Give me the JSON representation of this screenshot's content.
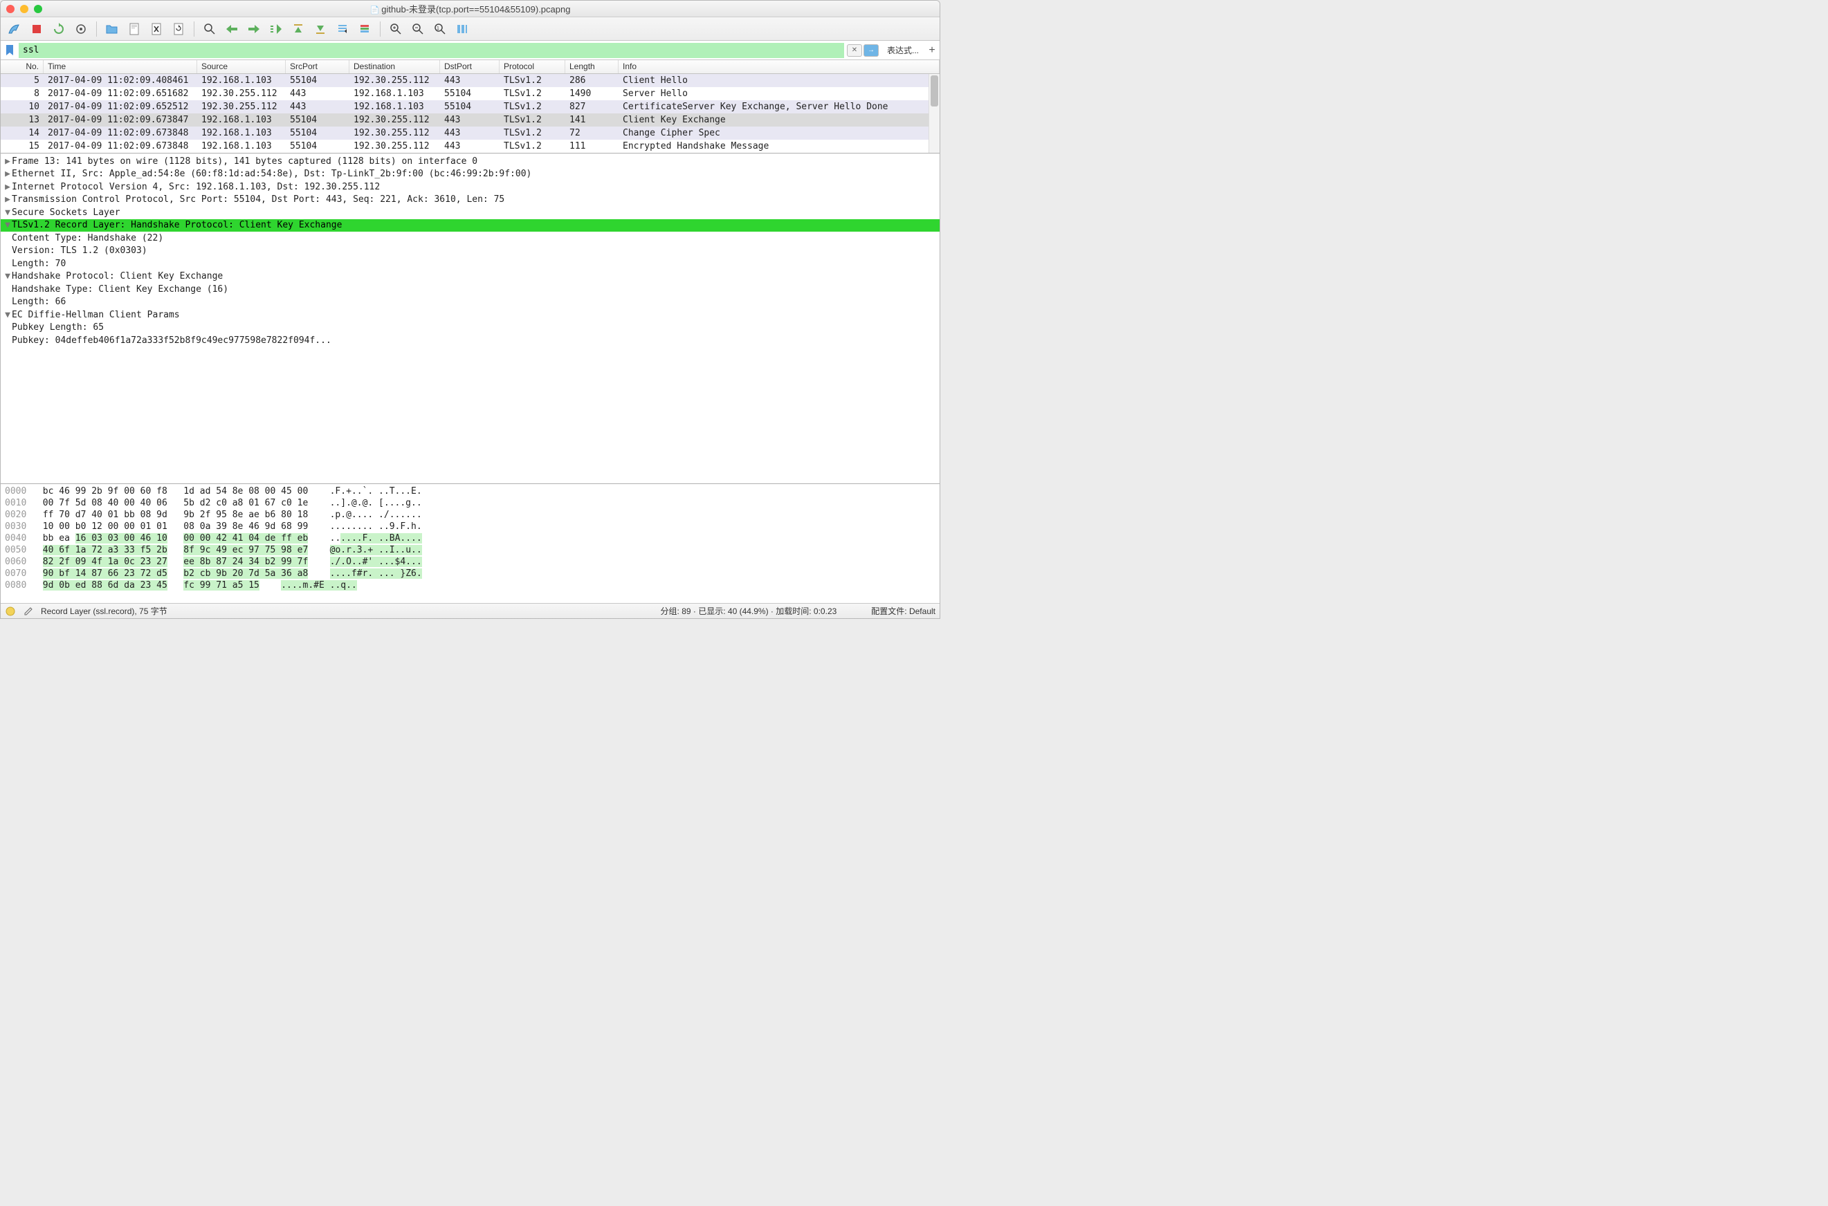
{
  "window": {
    "title": "github-未登录(tcp.port==55104&55109).pcapng"
  },
  "filter": {
    "value": "ssl",
    "expression_label": "表达式...",
    "plus": "+"
  },
  "columns": {
    "no": "No.",
    "time": "Time",
    "src": "Source",
    "sport": "SrcPort",
    "dst": "Destination",
    "dport": "DstPort",
    "proto": "Protocol",
    "len": "Length",
    "info": "Info"
  },
  "rows": [
    {
      "no": "5",
      "time": "2017-04-09 11:02:09.408461",
      "src": "192.168.1.103",
      "sport": "55104",
      "dst": "192.30.255.112",
      "dport": "443",
      "proto": "TLSv1.2",
      "len": "286",
      "info": "Client Hello",
      "sel": false,
      "even": true
    },
    {
      "no": "8",
      "time": "2017-04-09 11:02:09.651682",
      "src": "192.30.255.112",
      "sport": "443",
      "dst": "192.168.1.103",
      "dport": "55104",
      "proto": "TLSv1.2",
      "len": "1490",
      "info": "Server Hello",
      "sel": false,
      "even": false
    },
    {
      "no": "10",
      "time": "2017-04-09 11:02:09.652512",
      "src": "192.30.255.112",
      "sport": "443",
      "dst": "192.168.1.103",
      "dport": "55104",
      "proto": "TLSv1.2",
      "len": "827",
      "info": "CertificateServer Key Exchange, Server Hello Done",
      "sel": false,
      "even": true
    },
    {
      "no": "13",
      "time": "2017-04-09 11:02:09.673847",
      "src": "192.168.1.103",
      "sport": "55104",
      "dst": "192.30.255.112",
      "dport": "443",
      "proto": "TLSv1.2",
      "len": "141",
      "info": "Client Key Exchange",
      "sel": true,
      "even": false
    },
    {
      "no": "14",
      "time": "2017-04-09 11:02:09.673848",
      "src": "192.168.1.103",
      "sport": "55104",
      "dst": "192.30.255.112",
      "dport": "443",
      "proto": "TLSv1.2",
      "len": "72",
      "info": "Change Cipher Spec",
      "sel": false,
      "even": true
    },
    {
      "no": "15",
      "time": "2017-04-09 11:02:09.673848",
      "src": "192.168.1.103",
      "sport": "55104",
      "dst": "192.30.255.112",
      "dport": "443",
      "proto": "TLSv1.2",
      "len": "111",
      "info": "Encrypted Handshake Message",
      "sel": false,
      "even": false
    }
  ],
  "tree": [
    {
      "ind": 0,
      "tog": "▶",
      "text": "Frame 13: 141 bytes on wire (1128 bits), 141 bytes captured (1128 bits) on interface 0"
    },
    {
      "ind": 0,
      "tog": "▶",
      "text": "Ethernet II, Src: Apple_ad:54:8e (60:f8:1d:ad:54:8e), Dst: Tp-LinkT_2b:9f:00 (bc:46:99:2b:9f:00)"
    },
    {
      "ind": 0,
      "tog": "▶",
      "text": "Internet Protocol Version 4, Src: 192.168.1.103, Dst: 192.30.255.112"
    },
    {
      "ind": 0,
      "tog": "▶",
      "text": "Transmission Control Protocol, Src Port: 55104, Dst Port: 443, Seq: 221, Ack: 3610, Len: 75"
    },
    {
      "ind": 0,
      "tog": "▼",
      "text": "Secure Sockets Layer"
    },
    {
      "ind": 1,
      "tog": "▼",
      "text": "TLSv1.2 Record Layer: Handshake Protocol: Client Key Exchange",
      "hl": true
    },
    {
      "ind": 2,
      "tog": " ",
      "text": "Content Type: Handshake (22)"
    },
    {
      "ind": 2,
      "tog": " ",
      "text": "Version: TLS 1.2 (0x0303)"
    },
    {
      "ind": 2,
      "tog": " ",
      "text": "Length: 70"
    },
    {
      "ind": 2,
      "tog": "▼",
      "text": "Handshake Protocol: Client Key Exchange"
    },
    {
      "ind": 3,
      "tog": " ",
      "text": "Handshake Type: Client Key Exchange (16)"
    },
    {
      "ind": 3,
      "tog": " ",
      "text": "Length: 66"
    },
    {
      "ind": 3,
      "tog": "▼",
      "text": "EC Diffie-Hellman Client Params"
    },
    {
      "ind": 4,
      "tog": " ",
      "text": "Pubkey Length: 65"
    },
    {
      "ind": 4,
      "tog": " ",
      "text": "Pubkey: 04deffeb406f1a72a333f52b8f9c49ec977598e7822f094f..."
    }
  ],
  "hex": [
    {
      "off": "0000",
      "b1": "bc 46 99 2b 9f 00 60 f8",
      "b2": "1d ad 54 8e 08 00 45 00",
      "a": ".F.+..`. ..T...E."
    },
    {
      "off": "0010",
      "b1": "00 7f 5d 08 40 00 40 06",
      "b2": "5b d2 c0 a8 01 67 c0 1e",
      "a": "..].@.@. [....g.."
    },
    {
      "off": "0020",
      "b1": "ff 70 d7 40 01 bb 08 9d",
      "b2": "9b 2f 95 8e ae b6 80 18",
      "a": ".p.@.... ./......"
    },
    {
      "off": "0030",
      "b1": "10 00 b0 12 00 00 01 01",
      "b2": "08 0a 39 8e 46 9d 68 99",
      "a": "........ ..9.F.h."
    },
    {
      "off": "0040",
      "b1": "bb ea ",
      "b1h": "16 03 03 00 46 10",
      "b2h": "00 00 42 41 04 de ff eb",
      "a": "..",
      "ah": "....F. ..BA...."
    },
    {
      "off": "0050",
      "b1h": "40 6f 1a 72 a3 33 f5 2b",
      "b2h": "8f 9c 49 ec 97 75 98 e7",
      "ah": "@o.r.3.+ ..I..u.."
    },
    {
      "off": "0060",
      "b1h": "82 2f 09 4f 1a 0c 23 27",
      "b2h": "ee 8b 87 24 34 b2 99 7f",
      "ah": "./.O..#' ...$4..."
    },
    {
      "off": "0070",
      "b1h": "90 bf 14 87 66 23 72 d5",
      "b2h": "b2 cb 9b 20 7d 5a 36 a8",
      "ah": "....f#r. ... }Z6."
    },
    {
      "off": "0080",
      "b1h": "9d 0b ed 88 6d da 23 45",
      "b2h": "fc 99 71 a5 15",
      "ah": "....m.#E ..q.."
    }
  ],
  "status": {
    "left": "Record Layer (ssl.record), 75 字节",
    "mid": "分组: 89 · 已显示: 40 (44.9%) · 加载时间: 0:0.23",
    "right": "配置文件: Default"
  }
}
